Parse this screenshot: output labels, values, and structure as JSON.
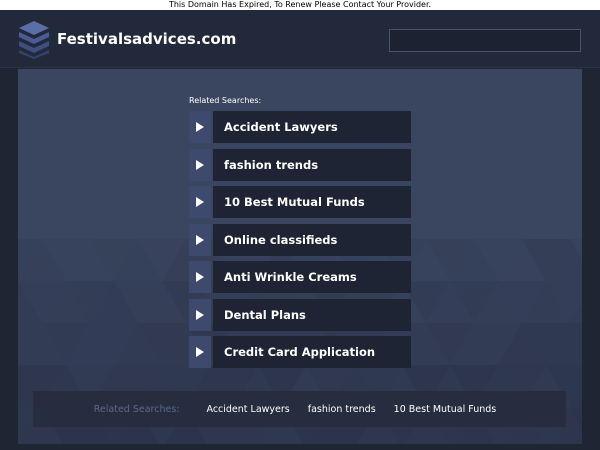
{
  "notice": "This Domain Has Expired, To Renew Please Contact Your Provider.",
  "header": {
    "site_name": "Festivalsadvices.com",
    "search_value": ""
  },
  "related": {
    "label": "Related Searches:",
    "items": [
      "Accident Lawyers",
      "fashion trends",
      "10 Best Mutual Funds",
      "Online classifieds",
      "Anti Wrinkle Creams",
      "Dental Plans",
      "Credit Card Application"
    ]
  },
  "footer": {
    "label": "Related Searches:",
    "links": [
      "Accident Lawyers",
      "fashion trends",
      "10 Best Mutual Funds"
    ]
  },
  "colors": {
    "background": "#1f2533",
    "panel": "#3a4560",
    "arrow_box": "#3e4a6d",
    "link_box": "#1e2433",
    "muted_label": "#5c6a8a"
  },
  "icons": {
    "logo": "stacked-layers-icon",
    "arrow": "play-triangle-icon"
  }
}
